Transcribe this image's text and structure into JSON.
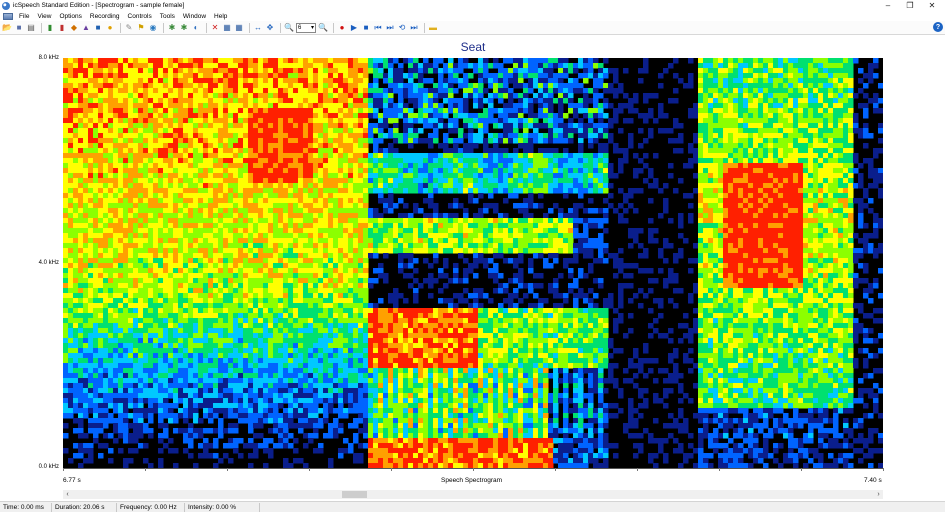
{
  "window": {
    "title": "icSpeech Standard Edition - [Spectrogram - sample female]",
    "minimize": "–",
    "restore": "❐",
    "close": "✕"
  },
  "menu": [
    "File",
    "View",
    "Options",
    "Recording",
    "Controls",
    "Tools",
    "Window",
    "Help"
  ],
  "toolbar": {
    "zoom_value": "6",
    "buttons": [
      {
        "name": "open-icon",
        "glyph": "📂",
        "color": "#d9a400"
      },
      {
        "name": "save-icon",
        "glyph": "■",
        "color": "#5a6fa8"
      },
      {
        "name": "print-icon",
        "glyph": "▤",
        "color": "#555555"
      },
      {
        "name": "sep"
      },
      {
        "name": "waveform-icon",
        "glyph": "▮",
        "color": "#2e8b2e"
      },
      {
        "name": "spectrogram-icon",
        "glyph": "▮",
        "color": "#c03030"
      },
      {
        "name": "pitch-icon",
        "glyph": "◆",
        "color": "#d07000"
      },
      {
        "name": "formant-icon",
        "glyph": "▲",
        "color": "#6a3fa0"
      },
      {
        "name": "energy-icon",
        "glyph": "■",
        "color": "#2060b0"
      },
      {
        "name": "spectrum-icon",
        "glyph": "●",
        "color": "#e0a000"
      },
      {
        "name": "sep"
      },
      {
        "name": "notes-icon",
        "glyph": "✎",
        "color": "#888888"
      },
      {
        "name": "marker-icon",
        "glyph": "⚑",
        "color": "#d0a000"
      },
      {
        "name": "snapshot-icon",
        "glyph": "◉",
        "color": "#2a7ac0"
      },
      {
        "name": "sep"
      },
      {
        "name": "analyze-icon",
        "glyph": "✱",
        "color": "#3a8a3a"
      },
      {
        "name": "compare-icon",
        "glyph": "✱",
        "color": "#3a8a3a"
      },
      {
        "name": "play-region-icon",
        "glyph": "◐",
        "color": "#3070c0"
      },
      {
        "name": "sep"
      },
      {
        "name": "delete-icon",
        "glyph": "✕",
        "color": "#d02020"
      },
      {
        "name": "split-icon",
        "glyph": "▦",
        "color": "#2a5aa0"
      },
      {
        "name": "merge-icon",
        "glyph": "▦",
        "color": "#2a5aa0"
      },
      {
        "name": "sep"
      },
      {
        "name": "fit-width-icon",
        "glyph": "↔",
        "color": "#2a6ac0"
      },
      {
        "name": "expand-icon",
        "glyph": "✥",
        "color": "#2a6ac0"
      },
      {
        "name": "sep"
      },
      {
        "name": "zoom-in-icon",
        "glyph": "🔍",
        "color": "#333333"
      },
      {
        "name": "zoom-select"
      },
      {
        "name": "zoom-out-icon",
        "glyph": "🔍",
        "color": "#333333"
      },
      {
        "name": "sep"
      },
      {
        "name": "record-icon",
        "glyph": "●",
        "color": "#d01010"
      },
      {
        "name": "play-icon",
        "glyph": "▶",
        "color": "#1a5ec0"
      },
      {
        "name": "stop-icon",
        "glyph": "■",
        "color": "#1a5ec0"
      },
      {
        "name": "rewind-icon",
        "glyph": "⏮",
        "color": "#1a5ec0"
      },
      {
        "name": "forward-icon",
        "glyph": "⏭",
        "color": "#1a5ec0"
      },
      {
        "name": "loop-icon",
        "glyph": "⟲",
        "color": "#1a5ec0"
      },
      {
        "name": "end-icon",
        "glyph": "⏭",
        "color": "#1a5ec0"
      },
      {
        "name": "sep"
      },
      {
        "name": "folder-icon",
        "glyph": "▬",
        "color": "#e0b020"
      }
    ]
  },
  "spectrogram": {
    "title": "Seat",
    "y_ticks": [
      "8.0 kHz",
      "4.0 kHz",
      "0.0 kHz"
    ],
    "x_start": "6.77 s",
    "x_end": "7.40 s",
    "x_caption": "Speech Spectrogram",
    "colormap": [
      "#000000",
      "#0a1e8c",
      "#0064ff",
      "#00c8ff",
      "#00e070",
      "#8cff00",
      "#ffff00",
      "#ffa000",
      "#ff2000"
    ]
  },
  "status": {
    "time": "Time: 0.00 ms",
    "duration": "Duration: 20.06 s",
    "frequency": "Frequency: 0.00 Hz",
    "intensity": "Intensity: 0.00 %"
  }
}
